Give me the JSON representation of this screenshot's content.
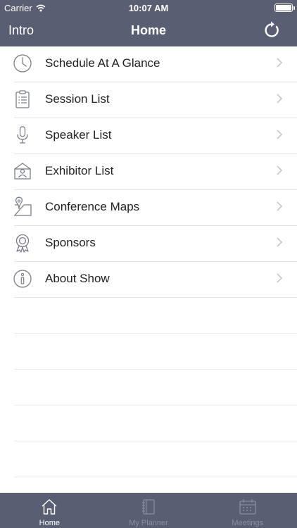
{
  "status_bar": {
    "carrier": "Carrier",
    "time": "10:07 AM"
  },
  "nav_bar": {
    "back_label": "Intro",
    "title": "Home"
  },
  "menu": {
    "items": [
      {
        "label": "Schedule At A Glance",
        "icon": "clock-icon"
      },
      {
        "label": "Session List",
        "icon": "clipboard-list-icon"
      },
      {
        "label": "Speaker List",
        "icon": "microphone-icon"
      },
      {
        "label": "Exhibitor List",
        "icon": "exhibitor-booth-icon"
      },
      {
        "label": "Conference Maps",
        "icon": "map-pin-icon"
      },
      {
        "label": "Sponsors",
        "icon": "award-ribbon-icon"
      },
      {
        "label": "About Show",
        "icon": "info-icon"
      }
    ]
  },
  "tab_bar": {
    "tabs": [
      {
        "label": "Home",
        "icon": "home-icon",
        "active": true
      },
      {
        "label": "My Planner",
        "icon": "notebook-icon",
        "active": false
      },
      {
        "label": "Meetings",
        "icon": "calendar-icon",
        "active": false
      }
    ]
  },
  "colors": {
    "bar_background": "#5a5e72",
    "inactive_tab": "#8a8da0",
    "icon_stroke": "#7a7d8c",
    "chevron": "#c7c7cc"
  }
}
